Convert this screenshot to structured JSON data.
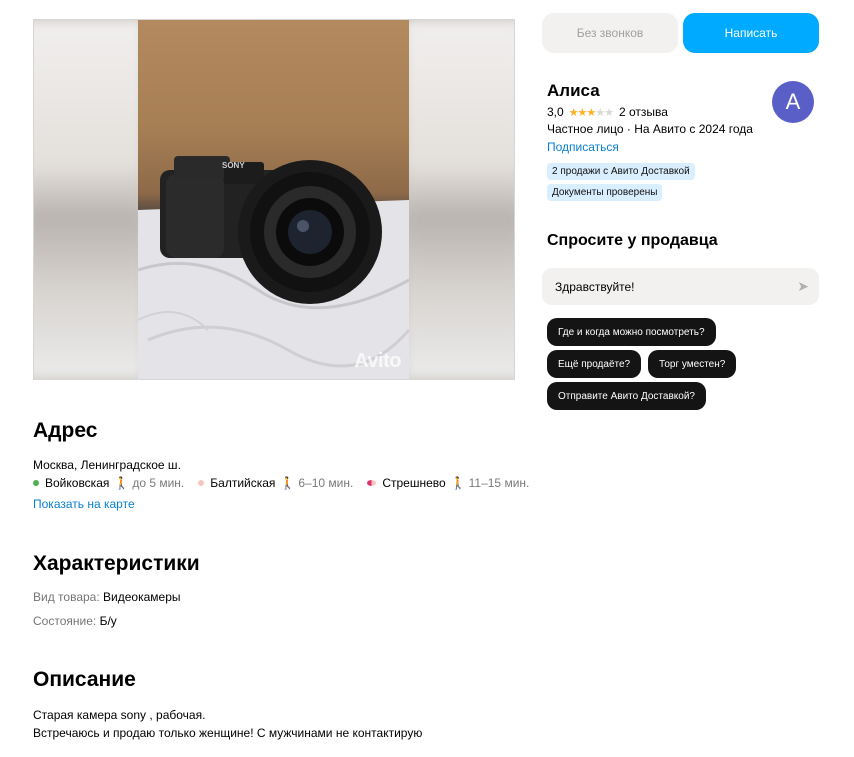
{
  "gallery": {
    "watermark": "Avito"
  },
  "address": {
    "title": "Адрес",
    "line": "Москва, Ленинградское ш.",
    "stations": [
      {
        "name": "Войковская",
        "time": "до 5 мин.",
        "color": "#4caf50"
      },
      {
        "name": "Балтийская",
        "time": "6–10 мин.",
        "color": "#f5c6c0"
      },
      {
        "name": "Стрешнево",
        "time": "11–15 мин.",
        "color": "#e0306a"
      }
    ],
    "walk_icon": "walk-icon",
    "map_link": "Показать на карте"
  },
  "specs": {
    "title": "Характеристики",
    "items": [
      {
        "label": "Вид товара:",
        "value": "Видеокамеры"
      },
      {
        "label": "Состояние:",
        "value": "Б/у"
      }
    ]
  },
  "description": {
    "title": "Описание",
    "lines": [
      "Старая камера sony , рабочая.",
      "Встречаюсь и продаю только женщине! С мужчинами не контактирую"
    ]
  },
  "actions": {
    "no_calls": "Без звонков",
    "write": "Написать",
    "accent": "#00aaff"
  },
  "seller": {
    "name": "Алиса",
    "rating": "3,0",
    "rating_stars": 3,
    "reviews": "2 отзыва",
    "meta": "Частное лицо · На Авито с 2024 года",
    "subscribe": "Подписаться",
    "badges": [
      "2 продажи с Авито Доставкой",
      "Документы проверены"
    ],
    "avatar_letter": "А",
    "avatar_color": "#5a5fc8"
  },
  "ask": {
    "title": "Спросите у продавца",
    "input_value": "Здравствуйте!",
    "send_icon": "send-icon",
    "chips": [
      "Где и когда можно посмотреть?",
      "Ещё продаёте?",
      "Торг уместен?",
      "Отправите Авито Доставкой?"
    ]
  }
}
